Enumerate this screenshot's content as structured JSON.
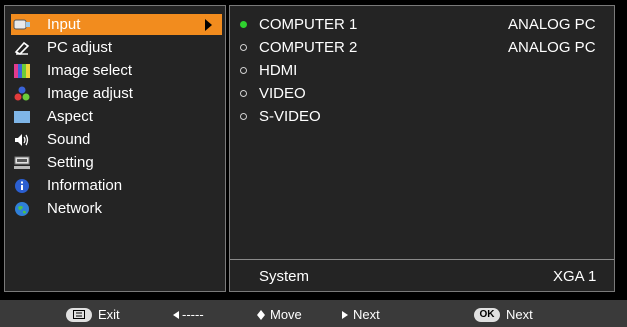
{
  "menu": {
    "items": [
      {
        "label": "Input",
        "icon": "input-icon",
        "selected": true
      },
      {
        "label": "PC adjust",
        "icon": "pc-adjust-icon"
      },
      {
        "label": "Image select",
        "icon": "image-select-icon"
      },
      {
        "label": "Image adjust",
        "icon": "image-adjust-icon"
      },
      {
        "label": "Aspect",
        "icon": "aspect-icon"
      },
      {
        "label": "Sound",
        "icon": "sound-icon"
      },
      {
        "label": "Setting",
        "icon": "setting-icon"
      },
      {
        "label": "Information",
        "icon": "information-icon"
      },
      {
        "label": "Network",
        "icon": "network-icon"
      }
    ]
  },
  "sources": [
    {
      "name": "COMPUTER 1",
      "mode": "ANALOG PC",
      "active": true
    },
    {
      "name": "COMPUTER 2",
      "mode": "ANALOG PC",
      "active": false
    },
    {
      "name": "HDMI",
      "mode": "",
      "active": false
    },
    {
      "name": "VIDEO",
      "mode": "",
      "active": false
    },
    {
      "name": "S-VIDEO",
      "mode": "",
      "active": false
    }
  ],
  "system": {
    "label": "System",
    "value": "XGA 1"
  },
  "nav": {
    "exit_label": "Exit",
    "back_label": "-----",
    "move_label": "Move",
    "next_label": "Next",
    "ok_key": "OK",
    "ok_label": "Next"
  },
  "colors": {
    "accent": "#f28c1e",
    "active_bullet": "#2fd12f",
    "panel": "#242424"
  }
}
